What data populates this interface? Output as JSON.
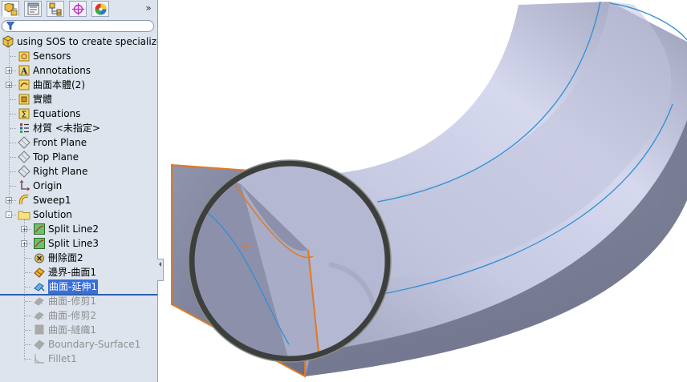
{
  "feature_manager": {
    "tabs": [
      {
        "icon": "feature-tree-icon",
        "active": true
      },
      {
        "icon": "property-manager-icon",
        "active": false
      },
      {
        "icon": "configuration-manager-icon",
        "active": false
      },
      {
        "icon": "dimxpert-icon",
        "active": false
      },
      {
        "icon": "appearance-icon",
        "active": false
      }
    ],
    "more_glyph": "»",
    "filter_icon": "filter-icon",
    "tree": [
      {
        "label": "using SOS to create specialize",
        "icon": "part-icon",
        "level": 0,
        "expander": "",
        "state": "normal"
      },
      {
        "label": "Sensors",
        "icon": "sensors-icon",
        "level": 1,
        "expander": "",
        "state": "normal"
      },
      {
        "label": "Annotations",
        "icon": "annotations-icon",
        "level": 1,
        "expander": "+",
        "state": "normal"
      },
      {
        "label": "曲面本體(2)",
        "icon": "surface-bodies-icon",
        "level": 1,
        "expander": "+",
        "state": "normal"
      },
      {
        "label": "實體",
        "icon": "solid-bodies-icon",
        "level": 1,
        "expander": "",
        "state": "normal"
      },
      {
        "label": "Equations",
        "icon": "equations-icon",
        "level": 1,
        "expander": "",
        "state": "normal"
      },
      {
        "label": "材質 <未指定>",
        "icon": "material-icon",
        "level": 1,
        "expander": "",
        "state": "normal"
      },
      {
        "label": "Front Plane",
        "icon": "plane-icon",
        "level": 1,
        "expander": "",
        "state": "normal"
      },
      {
        "label": "Top Plane",
        "icon": "plane-icon",
        "level": 1,
        "expander": "",
        "state": "normal"
      },
      {
        "label": "Right Plane",
        "icon": "plane-icon",
        "level": 1,
        "expander": "",
        "state": "normal"
      },
      {
        "label": "Origin",
        "icon": "origin-icon",
        "level": 1,
        "expander": "",
        "state": "normal"
      },
      {
        "label": "Sweep1",
        "icon": "sweep-icon",
        "level": 1,
        "expander": "+",
        "state": "normal"
      },
      {
        "label": "Solution",
        "icon": "folder-icon",
        "level": 1,
        "expander": "-",
        "state": "normal"
      },
      {
        "label": "Split Line2",
        "icon": "split-line-icon",
        "level": 2,
        "expander": "+",
        "state": "normal"
      },
      {
        "label": "Split Line3",
        "icon": "split-line-icon",
        "level": 2,
        "expander": "+",
        "state": "normal"
      },
      {
        "label": "刪除面2",
        "icon": "delete-face-icon",
        "level": 2,
        "expander": "",
        "state": "normal"
      },
      {
        "label": "邊界-曲面1",
        "icon": "boundary-surface-icon",
        "level": 2,
        "expander": "",
        "state": "normal"
      },
      {
        "label": "曲面-延伸1",
        "icon": "extend-surface-icon",
        "level": 2,
        "expander": "",
        "state": "selected"
      },
      {
        "label": "曲面-修剪1",
        "icon": "trim-surface-icon",
        "level": 2,
        "expander": "",
        "state": "suppressed"
      },
      {
        "label": "曲面-修剪2",
        "icon": "trim-surface-icon",
        "level": 2,
        "expander": "",
        "state": "suppressed"
      },
      {
        "label": "曲面-縫織1",
        "icon": "knit-surface-icon",
        "level": 2,
        "expander": "",
        "state": "suppressed"
      },
      {
        "label": "Boundary-Surface1",
        "icon": "boundary-surface-icon",
        "level": 2,
        "expander": "",
        "state": "suppressed"
      },
      {
        "label": "Fillet1",
        "icon": "fillet-icon",
        "level": 2,
        "expander": "",
        "state": "suppressed"
      }
    ]
  },
  "colors": {
    "panel_bg": "#dde4ee",
    "selection": "#3a6fd8",
    "rollback_bar": "#2f5fae",
    "surface_light": "#c9cde4",
    "surface_dark": "#7a7e98",
    "edge_blue": "#2f8fd6",
    "edge_orange": "#e07a1f",
    "magnifier_ring": "#4a4c4a"
  }
}
